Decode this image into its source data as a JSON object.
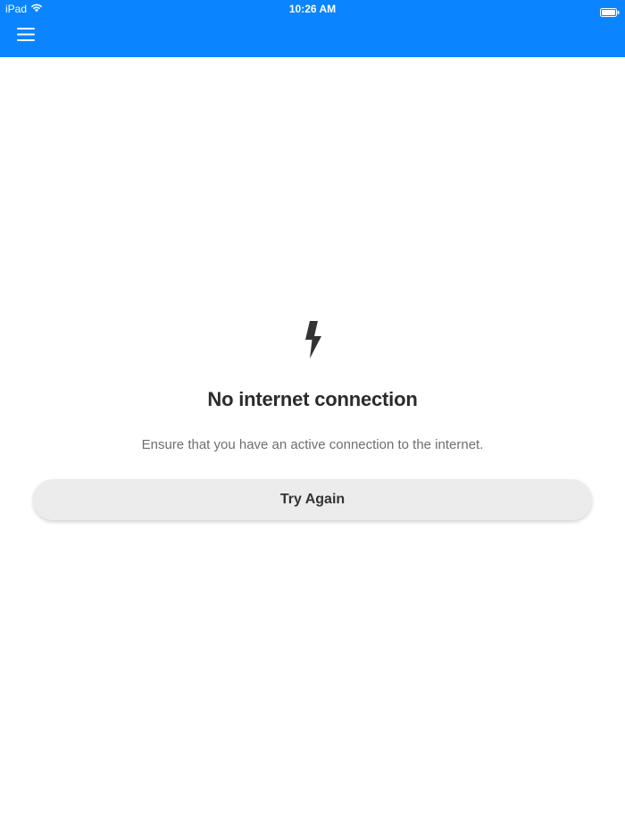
{
  "status_bar": {
    "device": "iPad",
    "time": "10:26 AM"
  },
  "header": {
    "menu_icon": "hamburger-menu-icon",
    "color": "#0a84ff"
  },
  "error_state": {
    "icon": "lightning-bolt-icon",
    "title": "No internet connection",
    "message": "Ensure that you have an active connection to the internet.",
    "retry_label": "Try Again"
  }
}
